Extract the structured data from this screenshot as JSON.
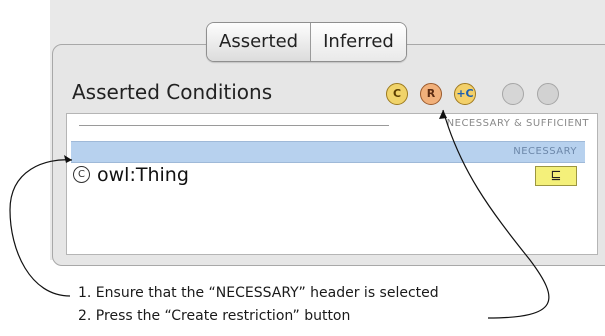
{
  "tabs": [
    {
      "label": "Asserted",
      "active": true
    },
    {
      "label": "Inferred",
      "active": false
    }
  ],
  "panel": {
    "title": "Asserted Conditions"
  },
  "toolbar": [
    {
      "name": "create-class-button",
      "glyph": "C"
    },
    {
      "name": "create-restriction-button",
      "glyph": "R"
    },
    {
      "name": "add-named-class-button",
      "glyph": "+C"
    },
    {
      "name": "search-condition-button",
      "glyph": ""
    },
    {
      "name": "delete-condition-button",
      "glyph": ""
    }
  ],
  "conditions": {
    "necessary_sufficient_header": "NECESSARY & SUFFICIENT",
    "necessary_header": "NECESSARY",
    "item": {
      "icon": "C",
      "label": "owl:Thing",
      "relation": "⊑"
    }
  },
  "instructions": [
    "1.   Ensure that the “NECESSARY” header is selected",
    "2.   Press the “Create restriction” button"
  ]
}
